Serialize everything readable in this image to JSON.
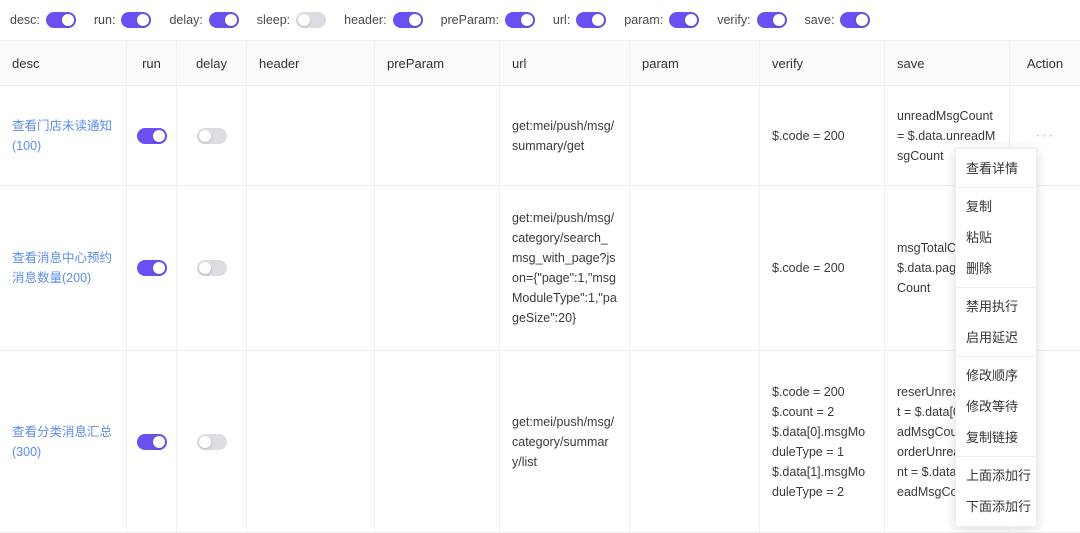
{
  "toolbar": {
    "toggles": [
      {
        "label": "desc:",
        "state": "on"
      },
      {
        "label": "run:",
        "state": "on"
      },
      {
        "label": "delay:",
        "state": "on"
      },
      {
        "label": "sleep:",
        "state": "off"
      },
      {
        "label": "header:",
        "state": "on"
      },
      {
        "label": "preParam:",
        "state": "on"
      },
      {
        "label": "url:",
        "state": "on"
      },
      {
        "label": "param:",
        "state": "on"
      },
      {
        "label": "verify:",
        "state": "on"
      },
      {
        "label": "save:",
        "state": "on"
      }
    ]
  },
  "table": {
    "headers": [
      "desc",
      "run",
      "delay",
      "header",
      "preParam",
      "url",
      "param",
      "verify",
      "save",
      "Action"
    ],
    "rows": [
      {
        "desc": "查看门店未读通知(100)",
        "run": "on",
        "delay": "off",
        "header": "",
        "preParam": "",
        "url": "get:mei/push/msg/summary/get",
        "param": "",
        "verify": "$.code = 200",
        "save": "unreadMsgCount = $.data.unreadMsgCount",
        "action": "···"
      },
      {
        "desc": "查看消息中心预约消息数量(200)",
        "run": "on",
        "delay": "off",
        "header": "",
        "preParam": "",
        "url": "get:mei/push/msg/category/search_msg_with_page?json={\"page\":1,\"msgModuleType\":1,\"pageSize\":20}",
        "param": "",
        "verify": "$.code = 200",
        "save": "msgTotalCount = $.data.pageTotalCount",
        "action": ""
      },
      {
        "desc": "查看分类消息汇总(300)",
        "run": "on",
        "delay": "off",
        "header": "",
        "preParam": "",
        "url": "get:mei/push/msg/category/summary/list",
        "param": "",
        "verify": "$.code = 200\n$.count = 2\n$.data[0].msgModuleType = 1\n$.data[1].msgModuleType = 2",
        "save": "reserUnreadCount = $.data[0].unreadMsgCount\norderUnreadCount = $.data[1].unreadMsgCount",
        "action": ""
      }
    ]
  },
  "context_menu": {
    "groups": [
      [
        "查看详情"
      ],
      [
        "复制",
        "粘贴",
        "删除"
      ],
      [
        "禁用执行",
        "启用延迟"
      ],
      [
        "修改顺序",
        "修改等待",
        "复制链接"
      ],
      [
        "上面添加行",
        "下面添加行"
      ]
    ]
  },
  "colors": {
    "accent": "#6c4ff0",
    "link": "#5b8def",
    "toggle_off": "#dcdce2",
    "header_bg": "#fafafc"
  }
}
